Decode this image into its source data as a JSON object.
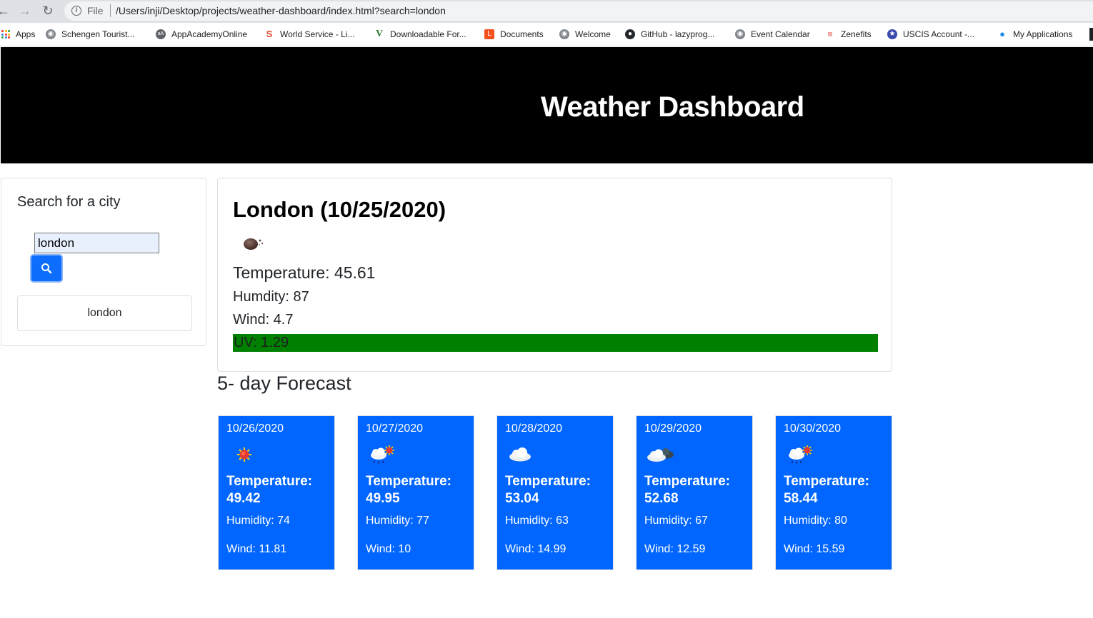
{
  "browser": {
    "file_label": "File",
    "url": "/Users/inji/Desktop/projects/weather-dashboard/index.html?search=london",
    "bookmarks": [
      {
        "label": "Apps",
        "icon": "apps-grid-icon"
      },
      {
        "label": "Schengen Tourist...",
        "icon": "globe-icon"
      },
      {
        "label": "AppAcademyOnline",
        "icon": "appacademy-icon"
      },
      {
        "label": "World Service - Li...",
        "icon": "s-logo-icon"
      },
      {
        "label": "Downloadable For...",
        "icon": "v-logo-icon"
      },
      {
        "label": "Documents",
        "icon": "documents-icon"
      },
      {
        "label": "Welcome",
        "icon": "globe-icon"
      },
      {
        "label": "GitHub - lazyprog...",
        "icon": "github-icon"
      },
      {
        "label": "Event Calendar",
        "icon": "globe-icon"
      },
      {
        "label": "Zenefits",
        "icon": "zenefits-icon"
      },
      {
        "label": "USCIS Account -...",
        "icon": "uscis-seal-icon"
      },
      {
        "label": "My Applications",
        "icon": "lightbulb-icon"
      }
    ]
  },
  "header": {
    "title": "Weather Dashboard"
  },
  "search": {
    "title": "Search for a city",
    "input_value": "london",
    "button_icon": "search-icon",
    "history": [
      "london"
    ]
  },
  "current": {
    "title": "London (10/25/2020)",
    "icon": "haze-night-icon",
    "temperature": "Temperature: 45.61",
    "humidity": "Humdity: 87",
    "wind": "Wind: 4.7",
    "uv": "UV: 1.29",
    "uv_color": "#008000"
  },
  "forecast": {
    "heading": "5- day Forecast",
    "card_color": "#0066ff",
    "days": [
      {
        "date": "10/26/2020",
        "icon": "sun-icon",
        "temperature": "Temperature: 49.42",
        "humidity": "Humidity: 74",
        "wind": "Wind: 11.81"
      },
      {
        "date": "10/27/2020",
        "icon": "rain-sun-icon",
        "temperature": "Temperature: 49.95",
        "humidity": "Humidity: 77",
        "wind": "Wind: 10"
      },
      {
        "date": "10/28/2020",
        "icon": "cloud-icon",
        "temperature": "Temperature: 53.04",
        "humidity": "Humidity: 63",
        "wind": "Wind: 14.99"
      },
      {
        "date": "10/29/2020",
        "icon": "broken-clouds-icon",
        "temperature": "Temperature: 52.68",
        "humidity": "Humidity: 67",
        "wind": "Wind: 12.59"
      },
      {
        "date": "10/30/2020",
        "icon": "rain-sun-icon",
        "temperature": "Temperature: 58.44",
        "humidity": "Humidity: 80",
        "wind": "Wind: 15.59"
      }
    ]
  }
}
